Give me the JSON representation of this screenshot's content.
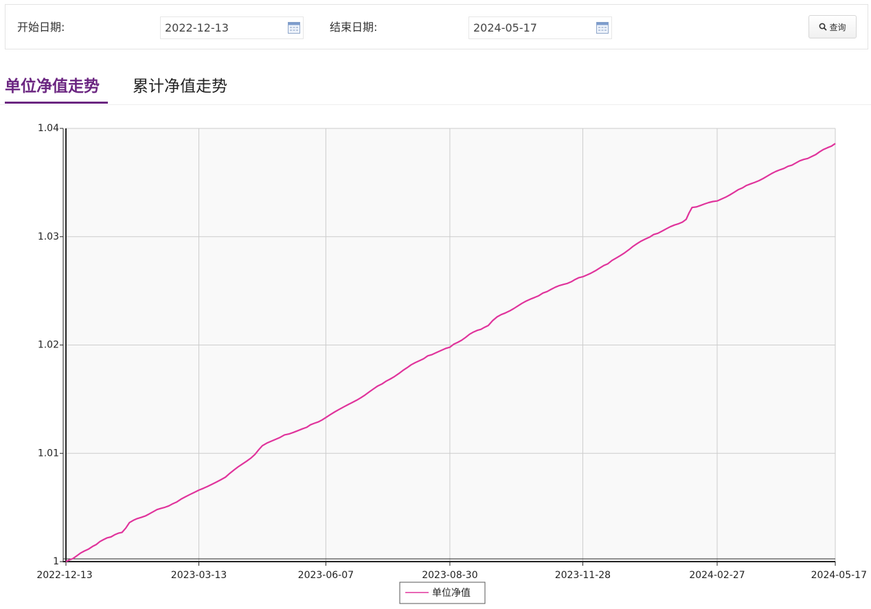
{
  "filters": {
    "start_label": "开始日期:",
    "start_value": "2022-12-13",
    "end_label": "结束日期:",
    "end_value": "2024-05-17",
    "query_label": "查询"
  },
  "tabs": [
    {
      "label": "单位净值走势",
      "active": true
    },
    {
      "label": "累计净值走势",
      "active": false
    }
  ],
  "colors": {
    "accent": "#6b2681",
    "line": "#e0339b",
    "plot_bg": "#f9f9f9",
    "grid": "#cccccc"
  },
  "icons": {
    "calendar": "calendar-icon",
    "search": "search-icon"
  },
  "chart_data": {
    "type": "line",
    "title": "",
    "xlabel": "",
    "ylabel": "",
    "ylim": [
      1.0,
      1.04
    ],
    "yticks": [
      1,
      1.01,
      1.02,
      1.03,
      1.04
    ],
    "ytick_labels": [
      "1",
      "1.01",
      "1.02",
      "1.03",
      "1.04"
    ],
    "xlim": [
      "2022-12-13",
      "2024-05-17"
    ],
    "xticks": [
      "2022-12-13",
      "2023-03-13",
      "2023-06-07",
      "2023-08-30",
      "2023-11-28",
      "2024-02-27",
      "2024-05-17"
    ],
    "grid": true,
    "legend": "bottom-center",
    "series": [
      {
        "name": "单位净值",
        "x": [
          "2022-12-13",
          "2022-12-20",
          "2022-12-31",
          "2023-01-10",
          "2023-01-20",
          "2023-01-25",
          "2023-02-10",
          "2023-02-26",
          "2023-03-13",
          "2023-03-31",
          "2023-04-20",
          "2023-04-25",
          "2023-05-10",
          "2023-05-25",
          "2023-06-07",
          "2023-06-25",
          "2023-07-15",
          "2023-08-01",
          "2023-08-15",
          "2023-08-30",
          "2023-09-15",
          "2023-09-25",
          "2023-10-01",
          "2023-10-15",
          "2023-11-01",
          "2023-11-15",
          "2023-11-28",
          "2023-12-15",
          "2024-01-01",
          "2024-01-15",
          "2024-02-01",
          "2024-02-06",
          "2024-02-10",
          "2024-02-27",
          "2024-03-15",
          "2024-04-01",
          "2024-04-15",
          "2024-05-01",
          "2024-05-17"
        ],
        "values": [
          1.0,
          1.0005,
          1.0014,
          1.0022,
          1.0027,
          1.0036,
          1.0046,
          1.0055,
          1.0066,
          1.0078,
          1.0099,
          1.0107,
          1.0117,
          1.0124,
          1.0133,
          1.0147,
          1.0164,
          1.0179,
          1.019,
          1.0198,
          1.0212,
          1.0218,
          1.0226,
          1.0236,
          1.0248,
          1.0256,
          1.0263,
          1.0275,
          1.0291,
          1.0302,
          1.0312,
          1.0316,
          1.0327,
          1.0333,
          1.0345,
          1.0356,
          1.0365,
          1.0374,
          1.0386
        ]
      }
    ]
  }
}
